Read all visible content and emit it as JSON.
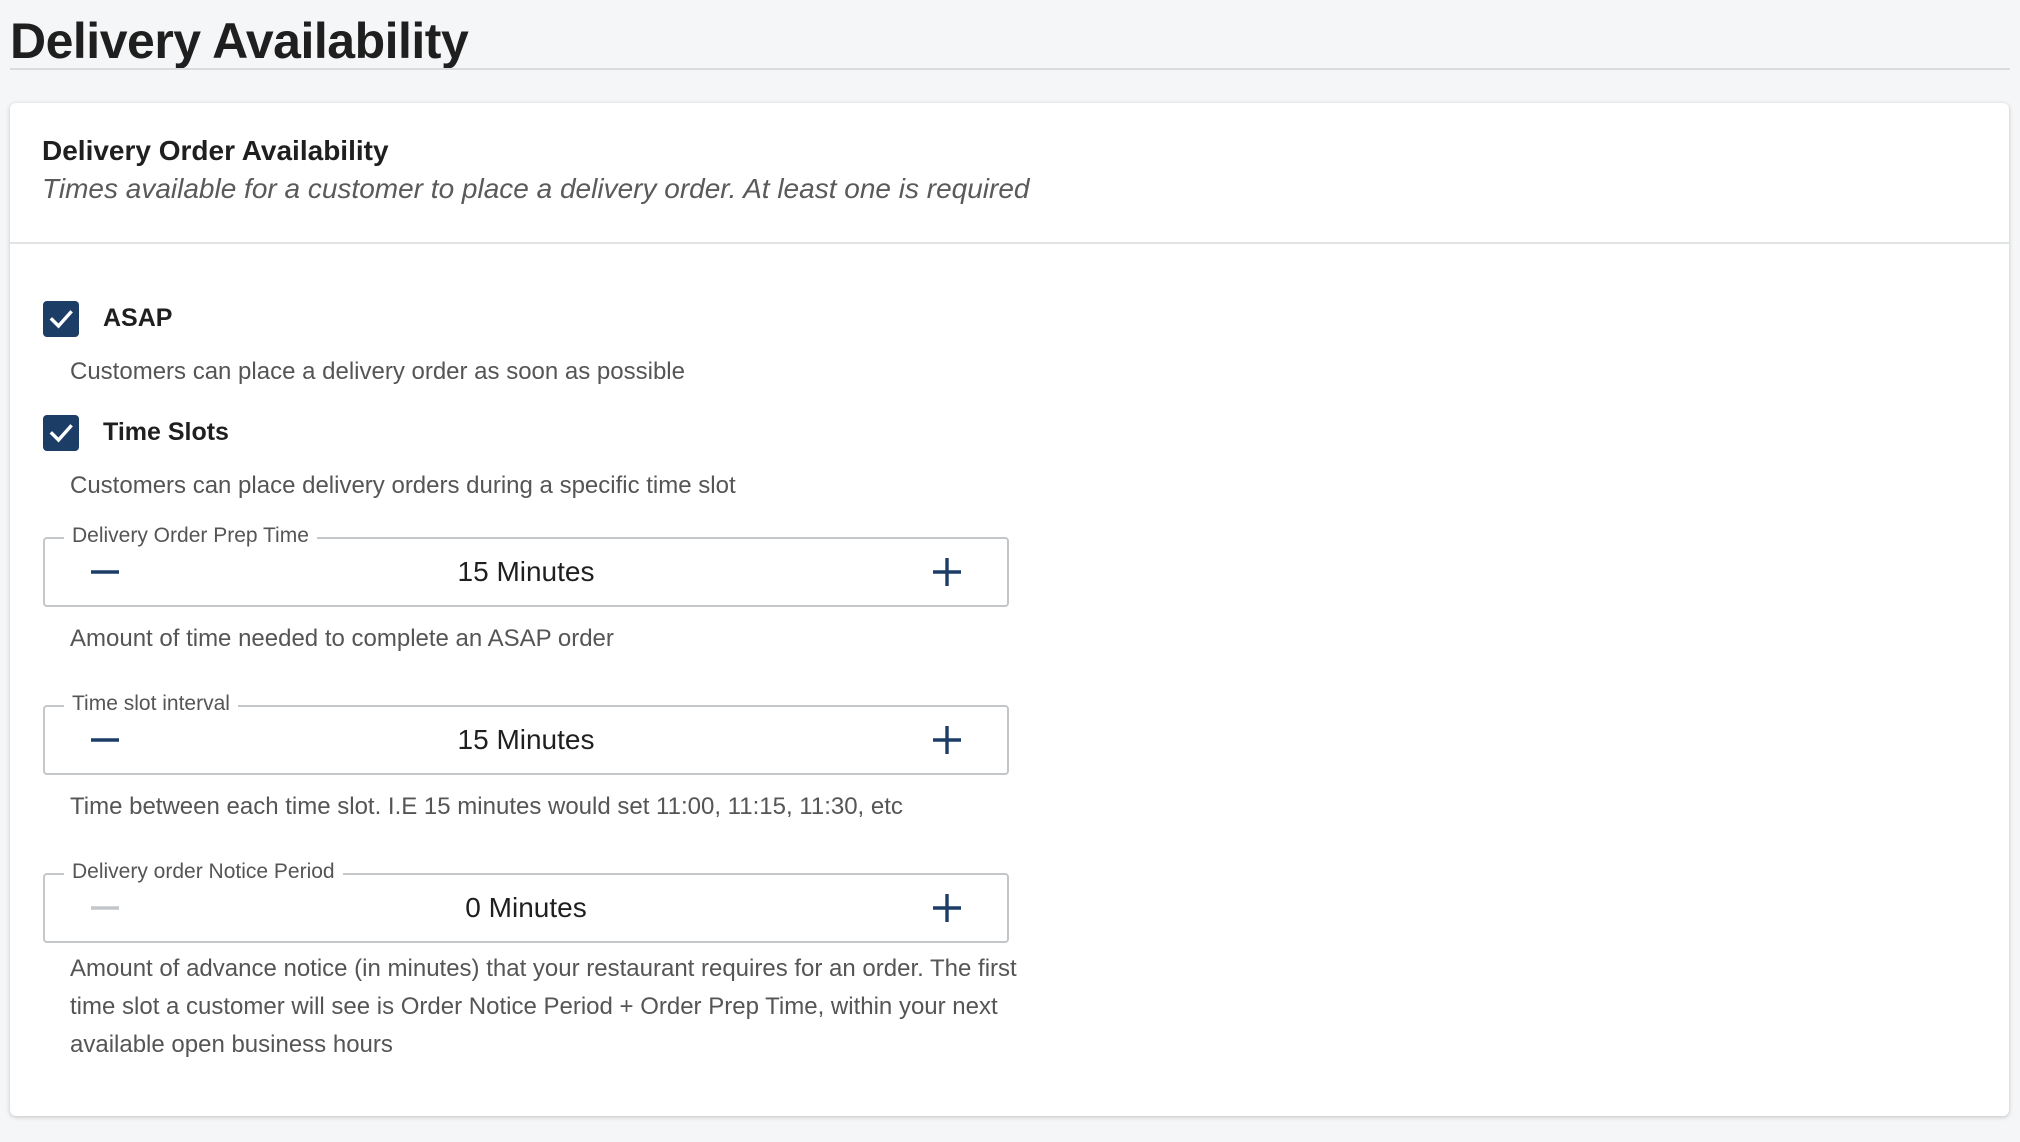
{
  "page": {
    "title": "Delivery Availability"
  },
  "card": {
    "title": "Delivery Order Availability",
    "subtitle": "Times available for a customer to place a delivery order. At least one is required"
  },
  "options": {
    "asap": {
      "label": "ASAP",
      "checked": true,
      "description": "Customers can place a delivery order as soon as possible"
    },
    "time_slots": {
      "label": "Time Slots",
      "checked": true,
      "description": "Customers can place delivery orders during a specific time slot"
    }
  },
  "steppers": {
    "prep_time": {
      "legend": "Delivery Order Prep Time",
      "value": "15 Minutes",
      "minus_enabled": true,
      "help": "Amount of time needed to complete an ASAP order"
    },
    "slot_interval": {
      "legend": "Time slot interval",
      "value": "15 Minutes",
      "minus_enabled": true,
      "help": "Time between each time slot. I.E 15 minutes would set 11:00, 11:15, 11:30, etc"
    },
    "notice_period": {
      "legend": "Delivery order Notice Period",
      "value": "0 Minutes",
      "minus_enabled": false,
      "help": "Amount of advance notice (in minutes) that your restaurant requires for an order. The first time slot a customer will see is Order Notice Period + Order Prep Time, within your next available open business hours"
    }
  },
  "icons": {
    "checkmark": "check-icon",
    "minus": "minus-icon",
    "plus": "plus-icon"
  },
  "colors": {
    "accent": "#1b3d66",
    "disabled": "#c4c7ca",
    "text": "#1f1f1f",
    "muted": "#555555"
  }
}
